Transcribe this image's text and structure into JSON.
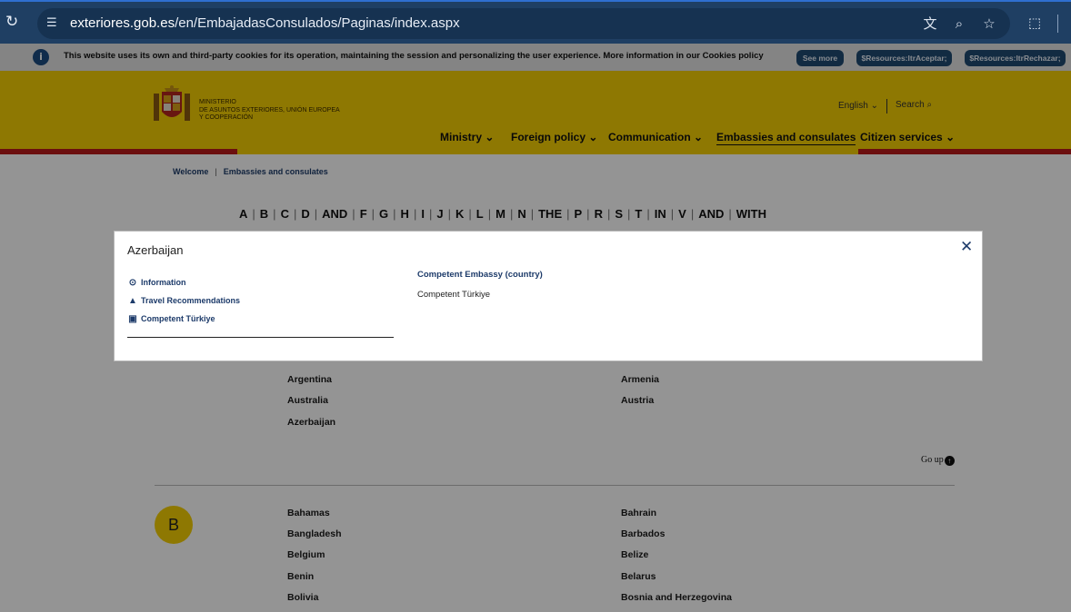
{
  "browser": {
    "url_domain": "exteriores.gob.es",
    "url_path": "/en/EmbajadasConsulados/Paginas/index.aspx"
  },
  "cookie_bar": {
    "text": "This website uses its own and third-party cookies for its operation, maintaining the session and personalizing the user experience. More information in our Cookies policy",
    "see_more": "See more",
    "accept": "$Resources:ltrAceptar;",
    "reject": "$Resources:ltrRechazar;"
  },
  "header": {
    "ministry_line1": "MINISTERIO",
    "ministry_line2": "DE ASUNTOS EXTERIORES, UNIÓN EUROPEA",
    "ministry_line3": "Y COOPERACIÓN",
    "language": "English",
    "search": "Search",
    "nav": [
      "Ministry",
      "Foreign policy",
      "Communication",
      "Embassies and consulates",
      "Citizen services"
    ]
  },
  "breadcrumb": [
    "Welcome",
    "Embassies and consulates"
  ],
  "alphabet": [
    "A",
    "B",
    "C",
    "D",
    "AND",
    "F",
    "G",
    "H",
    "I",
    "J",
    "K",
    "L",
    "M",
    "N",
    "THE",
    "P",
    "R",
    "S",
    "T",
    "IN",
    "V",
    "AND",
    "WITH"
  ],
  "countries_a": {
    "left": [
      "Argentina",
      "Australia",
      "Azerbaijan"
    ],
    "right": [
      "Armenia",
      "Austria"
    ]
  },
  "go_up": "Go up",
  "section_b": {
    "letter": "B",
    "left": [
      "Bahamas",
      "Bangladesh",
      "Belgium",
      "Benin",
      "Bolivia"
    ],
    "right": [
      "Bahrain",
      "Barbados",
      "Belize",
      "Belarus",
      "Bosnia and Herzegovina"
    ]
  },
  "modal": {
    "title": "Azerbaijan",
    "items": [
      "Information",
      "Travel Recommendations",
      "Competent Türkiye"
    ],
    "competent_heading": "Competent Embassy (country)",
    "competent_value": "Competent Türkiye"
  },
  "colors": {
    "header_yellow": "#f5cf05",
    "header_red": "#bb1b1b",
    "brand_blue": "#1d3b6a"
  }
}
